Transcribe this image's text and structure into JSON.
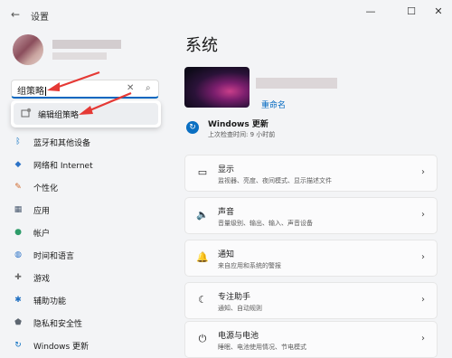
{
  "window": {
    "title": "设置",
    "back_glyph": "←",
    "min_glyph": "—",
    "max_glyph": "☐",
    "close_glyph": "✕"
  },
  "search": {
    "value": "组策略",
    "clear_glyph": "✕",
    "search_glyph": "⌕"
  },
  "suggestion": {
    "label": "编辑组策略"
  },
  "nav": [
    {
      "label": "蓝牙和其他设备",
      "icon": "bluetooth-icon",
      "glyph": "ᛒ",
      "color": "#0a6fc2"
    },
    {
      "label": "网络和 Internet",
      "icon": "wifi-icon",
      "glyph": "◆",
      "color": "#2b72c7"
    },
    {
      "label": "个性化",
      "icon": "brush-icon",
      "glyph": "✎",
      "color": "#d0682b"
    },
    {
      "label": "应用",
      "icon": "apps-icon",
      "glyph": "▦",
      "color": "#4a5a70"
    },
    {
      "label": "帐户",
      "icon": "account-icon",
      "glyph": "●",
      "color": "#2e9c6a"
    },
    {
      "label": "时间和语言",
      "icon": "globe-clock-icon",
      "glyph": "◍",
      "color": "#2b72c7"
    },
    {
      "label": "游戏",
      "icon": "gamepad-icon",
      "glyph": "✚",
      "color": "#6b6b6b"
    },
    {
      "label": "辅助功能",
      "icon": "accessibility-icon",
      "glyph": "✱",
      "color": "#1f6fc1"
    },
    {
      "label": "隐私和安全性",
      "icon": "shield-icon",
      "glyph": "⬟",
      "color": "#5d6670"
    },
    {
      "label": "Windows 更新",
      "icon": "update-icon",
      "glyph": "↻",
      "color": "#0a6fc2"
    }
  ],
  "main": {
    "title": "系统",
    "rename": "重命名",
    "update": {
      "title": "Windows 更新",
      "subtitle": "上次检查时间: 9 小时前",
      "glyph": "↻"
    },
    "cards": [
      {
        "title": "显示",
        "desc": "监视器、亮度、夜间模式、显示描述文件",
        "icon": "display-icon",
        "glyph": "▭"
      },
      {
        "title": "声音",
        "desc": "音量级别、输出、输入、声音设备",
        "icon": "speaker-icon",
        "glyph": "🔈"
      },
      {
        "title": "通知",
        "desc": "来自应用和系统的警报",
        "icon": "bell-icon",
        "glyph": "🔔"
      },
      {
        "title": "专注助手",
        "desc": "通知、自动规则",
        "icon": "moon-icon",
        "glyph": "☾"
      },
      {
        "title": "电源与电池",
        "desc": "睡眠、电池使用情况、节电模式",
        "icon": "power-icon",
        "glyph": "⏻"
      }
    ],
    "chevron_glyph": "›"
  },
  "annotation_color": "#e53935"
}
